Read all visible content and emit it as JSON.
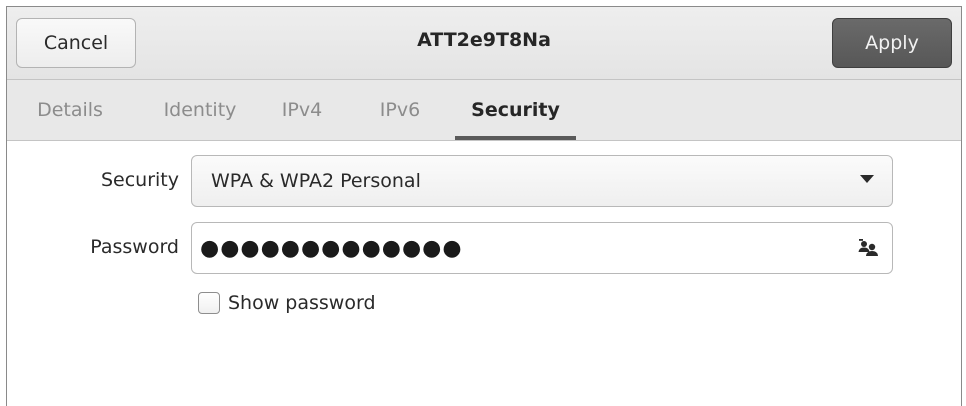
{
  "header": {
    "cancel_label": "Cancel",
    "title": "ATT2e9T8Na",
    "apply_label": "Apply"
  },
  "tabs": [
    {
      "label": "Details",
      "active": false
    },
    {
      "label": "Identity",
      "active": false
    },
    {
      "label": "IPv4",
      "active": false
    },
    {
      "label": "IPv6",
      "active": false
    },
    {
      "label": "Security",
      "active": true
    }
  ],
  "form": {
    "security": {
      "label": "Security",
      "selected": "WPA & WPA2 Personal"
    },
    "password": {
      "label": "Password",
      "masked_value": "●●●●●●●●●●●●●"
    },
    "show_password": {
      "label": "Show password",
      "checked": false
    }
  },
  "icons": {
    "dropdown": "chevron-down-icon",
    "reveal": "password-reveal-icon"
  },
  "colors": {
    "apply_button": "#5f5f5f",
    "active_tab_underline": "#5a5a5a",
    "tab_inactive_text": "#8c8c8c"
  }
}
